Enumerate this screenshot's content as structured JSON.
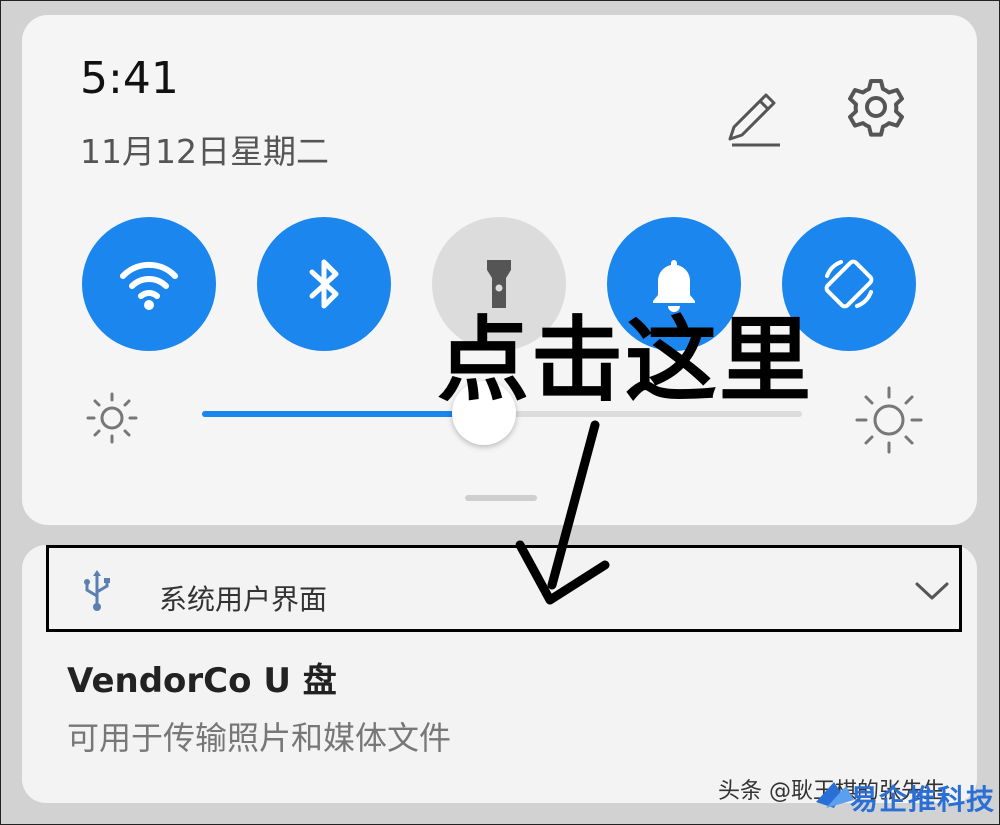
{
  "status": {
    "time": "5:41",
    "date": "11月12日星期二"
  },
  "header_icons": [
    "pencil-edit-icon",
    "gear-icon"
  ],
  "quick_tiles": [
    {
      "name": "wifi",
      "icon": "wifi-icon",
      "active": true
    },
    {
      "name": "bluetooth",
      "icon": "bluetooth-icon",
      "active": true
    },
    {
      "name": "flashlight",
      "icon": "flashlight-icon",
      "active": false
    },
    {
      "name": "sound",
      "icon": "bell-icon",
      "active": true
    },
    {
      "name": "auto-rotate",
      "icon": "rotate-icon",
      "active": true
    }
  ],
  "brightness": {
    "level": 0.47,
    "low_icon": "sun-small-icon",
    "high_icon": "sun-large-icon"
  },
  "notification": {
    "app_icon": "usb-icon",
    "app_name": "系统用户界面",
    "title": "VendorCo U 盘",
    "body": "可用于传输照片和媒体文件"
  },
  "annotation": {
    "text": "点击这里"
  },
  "watermark": {
    "text": "头条 @耿玉棋的张先生",
    "logo_text": "易企推科技"
  },
  "colors": {
    "accent": "#1a86ee",
    "tile_off": "#dcdcdc",
    "panel": "#f5f5f5"
  }
}
